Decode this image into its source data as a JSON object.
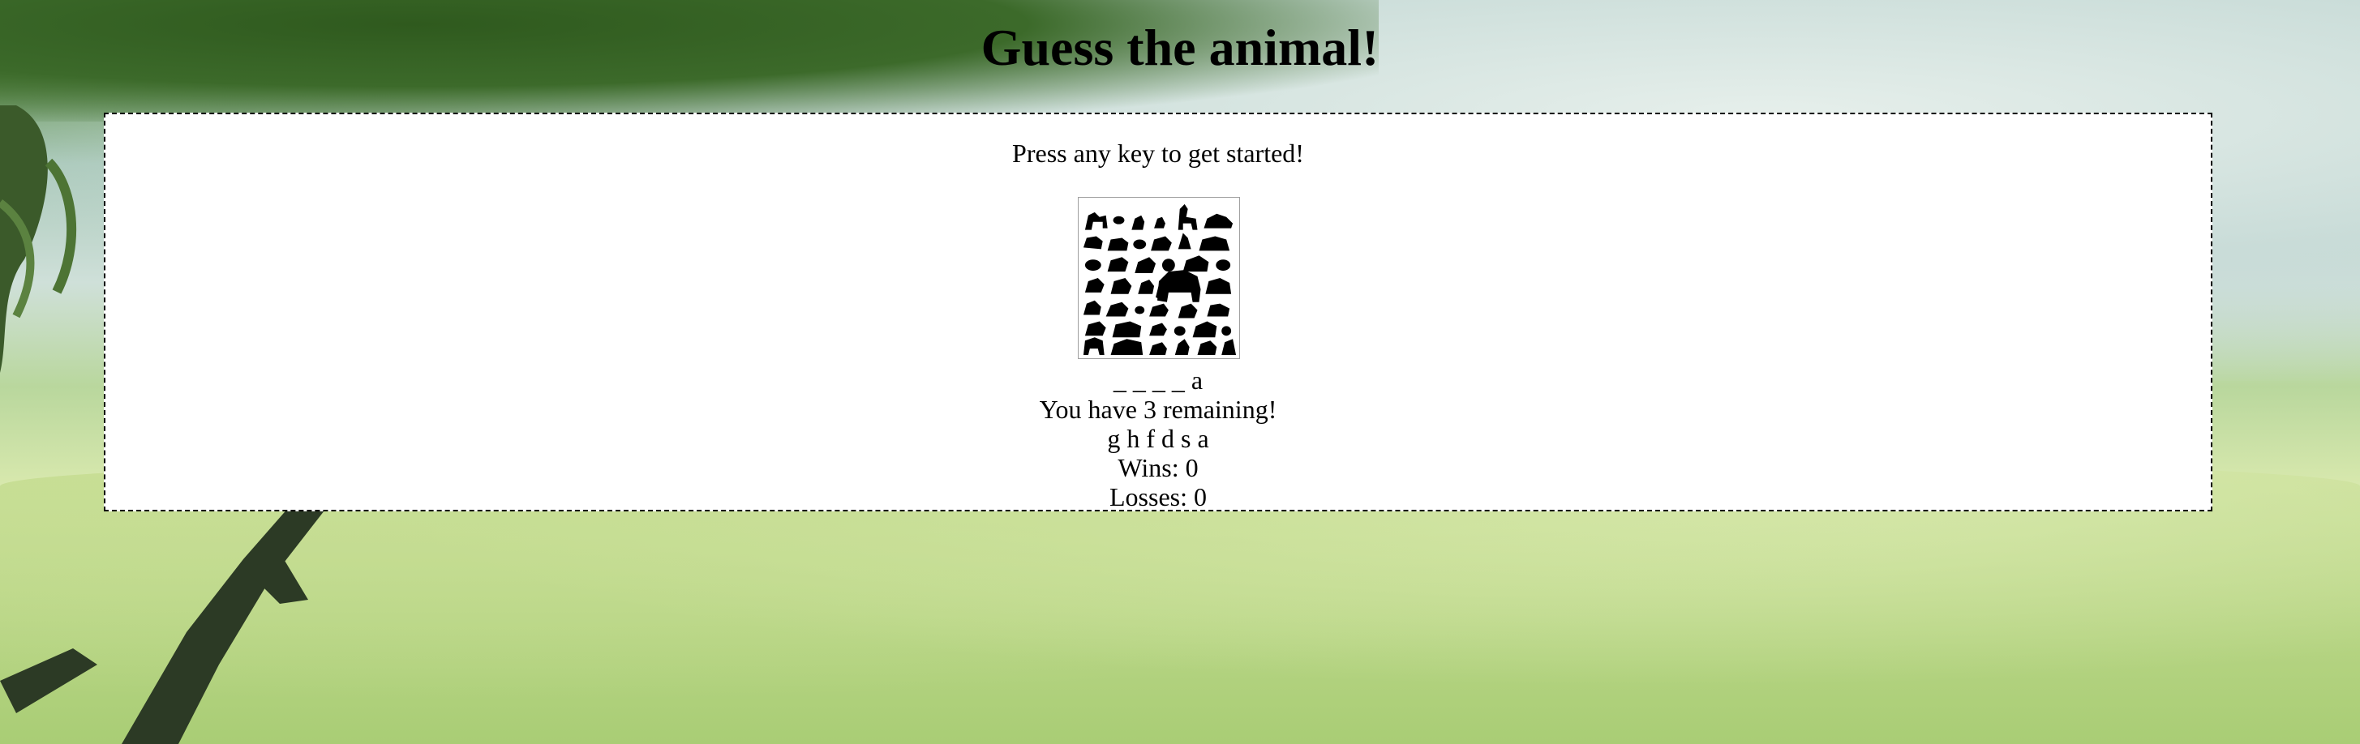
{
  "page": {
    "title": "Guess the animal!"
  },
  "game": {
    "prompt": "Press any key to get started!",
    "image_icon": "animal-silhouettes-collage",
    "word": "_ _ _ _ a",
    "remaining": "You have 3 remaining!",
    "guessed": "g h f d s a",
    "wins": "Wins: 0",
    "losses": "Losses: 0"
  },
  "colors": {
    "box_background": "#ffffff",
    "box_border": "#000000",
    "foliage_dark": "#3f6a2c",
    "foliage_light": "#cbe09a"
  }
}
